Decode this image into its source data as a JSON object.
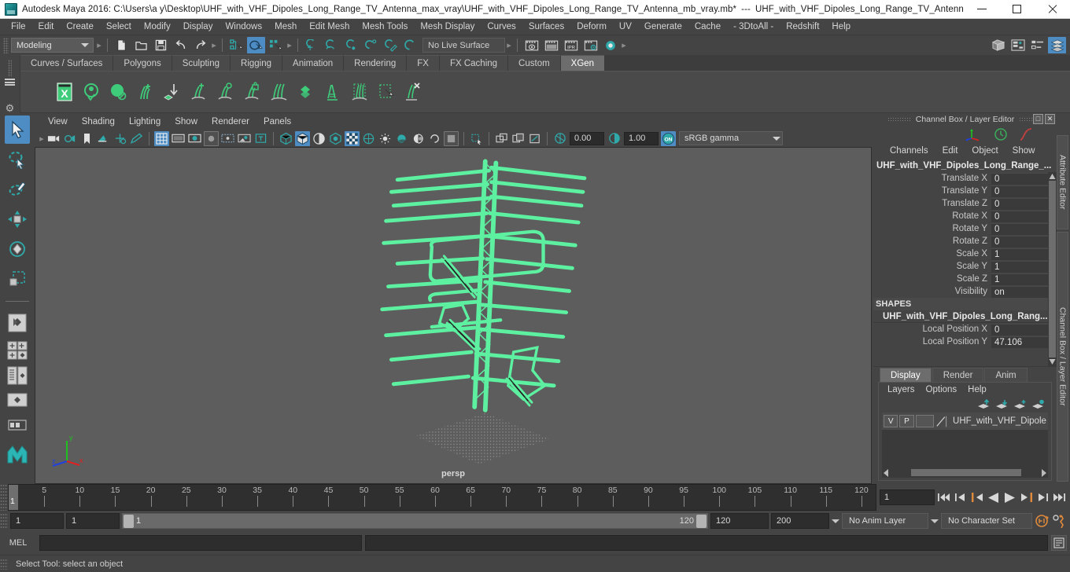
{
  "window": {
    "title": "Autodesk Maya 2016: C:\\Users\\a y\\Desktop\\UHF_with_VHF_Dipoles_Long_Range_TV_Antenna_max_vray\\UHF_with_VHF_Dipoles_Long_Range_TV_Antenna_mb_vray.mb*",
    "title_separator": "---",
    "title_secondary": "UHF_with_VHF_Dipoles_Long_Range_TV_Antenna_...",
    "app_icon": "maya-app-icon",
    "minimize": "minimize-button",
    "maximize": "maximize-button",
    "close": "close-button"
  },
  "menubar": {
    "items": [
      "File",
      "Edit",
      "Create",
      "Select",
      "Modify",
      "Display",
      "Windows",
      "Mesh",
      "Edit Mesh",
      "Mesh Tools",
      "Mesh Display",
      "Curves",
      "Surfaces",
      "Deform",
      "UV",
      "Generate",
      "Cache",
      "- 3DtoAll -",
      "Redshift",
      "Help"
    ]
  },
  "statusline": {
    "menuset": "Modeling",
    "live_surface": "No Live Surface",
    "selection_masks": [
      "hierarchy-select-icon",
      "object-select-icon",
      "component-select-icon"
    ],
    "file_buttons": [
      "new-scene-icon",
      "open-scene-icon",
      "save-scene-icon",
      "undo-icon",
      "redo-icon"
    ],
    "snap_buttons": [
      "snap-to-grid-icon",
      "snap-to-curve-icon",
      "snap-to-point-icon",
      "snap-to-projected-center-icon",
      "snap-to-view-plane-icon",
      "make-live-icon"
    ],
    "render_buttons": [
      "render-current-frame-icon",
      "render-sequence-icon",
      "ipr-render-icon",
      "render-settings-icon",
      "render-view-icon"
    ],
    "right_buttons": [
      "show-hide-modeling-toolkit-icon",
      "show-hide-attribute-editor-icon",
      "show-hide-tool-settings-icon",
      "show-hide-channel-box-icon"
    ]
  },
  "shelf": {
    "tabs": [
      "Curves / Surfaces",
      "Polygons",
      "Sculpting",
      "Rigging",
      "Animation",
      "Rendering",
      "FX",
      "FX Caching",
      "Custom",
      "XGen"
    ],
    "active_tab": "XGen",
    "icons": [
      "xgen-editor-icon",
      "xgen-sphere-check-icon",
      "xgen-sphere-slash-icon",
      "xgen-add-description-icon",
      "xgen-import-collection-icon",
      "xgen-groom-add-icon",
      "xgen-groom-density-icon",
      "xgen-groom-lock-icon",
      "xgen-groom-comb-icon",
      "xgen-patch-icon",
      "xgen-guide-tool-icon",
      "xgen-clump-icon",
      "xgen-select-region-icon",
      "xgen-delete-guides-icon"
    ]
  },
  "toolbox": {
    "tools": [
      "select-tool",
      "lasso-select-tool",
      "paint-select-tool",
      "move-tool",
      "rotate-tool",
      "scale-tool"
    ],
    "layouts": [
      "single-perspective-layout-icon",
      "four-view-layout-icon",
      "outliner-persp-layout-icon",
      "persp-graph-layout-icon",
      "hypershade-persp-layout-icon",
      "maya-logo-icon"
    ]
  },
  "viewport": {
    "menu": [
      "View",
      "Shading",
      "Lighting",
      "Show",
      "Renderer",
      "Panels"
    ],
    "camera_label": "persp",
    "exposure_value": "0.00",
    "gamma_value": "1.00",
    "color_management": "sRGB gamma",
    "gamma_toggle": "ON",
    "axis_gizmo": {
      "x": "x",
      "y": "y",
      "z": "z"
    },
    "toolbar_icons": [
      "select-camera-icon",
      "camera-attributes-icon",
      "bookmark-icon",
      "image-plane-icon",
      "two-d-pan-zoom-icon",
      "grease-pencil-icon",
      "grid-toggle-icon",
      "film-gate-icon",
      "resolution-gate-icon",
      "gate-mask-icon",
      "film-origin-icon",
      "exposure-icon",
      "hud-toggle-icon",
      "wireframe-shading-icon",
      "smooth-shade-all-icon",
      "smooth-shade-selected-icon",
      "flat-shade-icon",
      "wireframe-on-shaded-icon",
      "texture-toggle-icon",
      "lights-toggle-icon",
      "shadows-toggle-icon",
      "screen-space-ao-icon",
      "motion-blur-icon",
      "multisample-icon",
      "depth-peeling-icon",
      "xray-toggle-icon",
      "xray-joints-icon",
      "xray-active-components-icon",
      "exposure-control-icon",
      "gamma-control-icon"
    ]
  },
  "channelbox": {
    "panel_title": "Channel Box / Layer Editor",
    "restore_icon": "restore-panel-icon",
    "close_icon": "close-panel-icon",
    "gizmo_icons": [
      "transform-axis-icon",
      "clock-icon",
      "curve-icon"
    ],
    "menu": [
      "Channels",
      "Edit",
      "Object",
      "Show"
    ],
    "object_name": "UHF_with_VHF_Dipoles_Long_Range_...",
    "transform_rows": [
      {
        "label": "Translate X",
        "value": "0"
      },
      {
        "label": "Translate Y",
        "value": "0"
      },
      {
        "label": "Translate Z",
        "value": "0"
      },
      {
        "label": "Rotate X",
        "value": "0"
      },
      {
        "label": "Rotate Y",
        "value": "0"
      },
      {
        "label": "Rotate Z",
        "value": "0"
      },
      {
        "label": "Scale X",
        "value": "1"
      },
      {
        "label": "Scale Y",
        "value": "1"
      },
      {
        "label": "Scale Z",
        "value": "1"
      },
      {
        "label": "Visibility",
        "value": "on"
      }
    ],
    "shapes_header": "SHAPES",
    "shape_name": "UHF_with_VHF_Dipoles_Long_Rang...",
    "shape_rows": [
      {
        "label": "Local Position X",
        "value": "0"
      },
      {
        "label": "Local Position Y",
        "value": "47.106"
      }
    ]
  },
  "layereditor": {
    "tabs": [
      "Display",
      "Render",
      "Anim"
    ],
    "active_tab": "Display",
    "menu": [
      "Layers",
      "Options",
      "Help"
    ],
    "buttons": [
      "move-layer-up-icon",
      "move-layer-down-icon",
      "new-layer-icon",
      "new-layer-from-selected-icon"
    ],
    "layer_row": {
      "visibility": "V",
      "playback": "P",
      "state": "",
      "color_swatch": "layer-color-swatch",
      "name": "UHF_with_VHF_Dipoles_"
    }
  },
  "sidetabs": [
    "Attribute Editor",
    "Channel Box / Layer Editor"
  ],
  "timeline": {
    "start_frame": "1",
    "ticks": [
      5,
      10,
      15,
      20,
      25,
      30,
      35,
      40,
      45,
      50,
      55,
      60,
      65,
      70,
      75,
      80,
      85,
      90,
      95,
      100,
      105,
      110,
      115,
      120
    ],
    "current_frame": "1",
    "playback_buttons": [
      "go-to-start-icon",
      "step-back-keyframe-icon",
      "step-back-frame-icon",
      "play-backwards-icon",
      "play-forwards-icon",
      "step-forward-frame-icon",
      "step-forward-keyframe-icon",
      "go-to-end-icon"
    ]
  },
  "rangeslider": {
    "anim_start": "1",
    "range_start": "1",
    "bar_start_label": "1",
    "bar_end_label": "120",
    "range_end": "120",
    "anim_end": "200",
    "anim_layer": "No Anim Layer",
    "character_set": "No Character Set",
    "auto_key_icon": "auto-keyframe-icon",
    "anim_prefs_icon": "animation-preferences-icon"
  },
  "commandline": {
    "label": "MEL",
    "input_value": "",
    "input_placeholder": "",
    "output_value": "",
    "script_editor_icon": "script-editor-icon"
  },
  "helpline": {
    "text": "Select Tool: select an object"
  },
  "colors": {
    "accent_blue": "#4e8cc4",
    "teal": "#2fa9a9",
    "model_green": "#5cf0a0",
    "orange": "#e08a3c",
    "panel_bg": "#444444",
    "viewport_bg": "#5d5d5d"
  }
}
